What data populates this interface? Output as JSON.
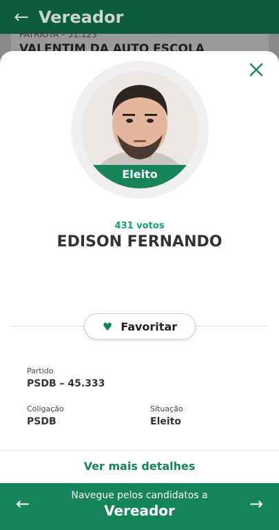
{
  "header": {
    "back_icon": "arrow-left-icon",
    "title": "Vereador"
  },
  "background_card": {
    "party": "PATRIOTA – 51.123",
    "name": "VALENTIM DA AUTO ESCOLA"
  },
  "modal": {
    "close_icon": "close-icon",
    "status_badge": "Eleito",
    "votes": "431 votos",
    "candidate_name": "EDISON FERNANDO",
    "favorite": {
      "icon": "heart-icon",
      "label": "Favoritar"
    },
    "fields": {
      "partido_label": "Partido",
      "partido_value": "PSDB – 45.333",
      "coligacao_label": "Coligação",
      "coligacao_value": "PSDB",
      "situacao_label": "Situação",
      "situacao_value": "Eleito"
    },
    "details_link": "Ver mais detalhes"
  },
  "footer": {
    "prev_icon": "arrow-left-icon",
    "next_icon": "arrow-right-icon",
    "nav_text": "Navegue pelos candidatos a",
    "nav_role": "Vereador"
  },
  "colors": {
    "primary": "#15845a",
    "header_dark": "#0d5d3c",
    "accent_text": "#1b9a6a"
  }
}
